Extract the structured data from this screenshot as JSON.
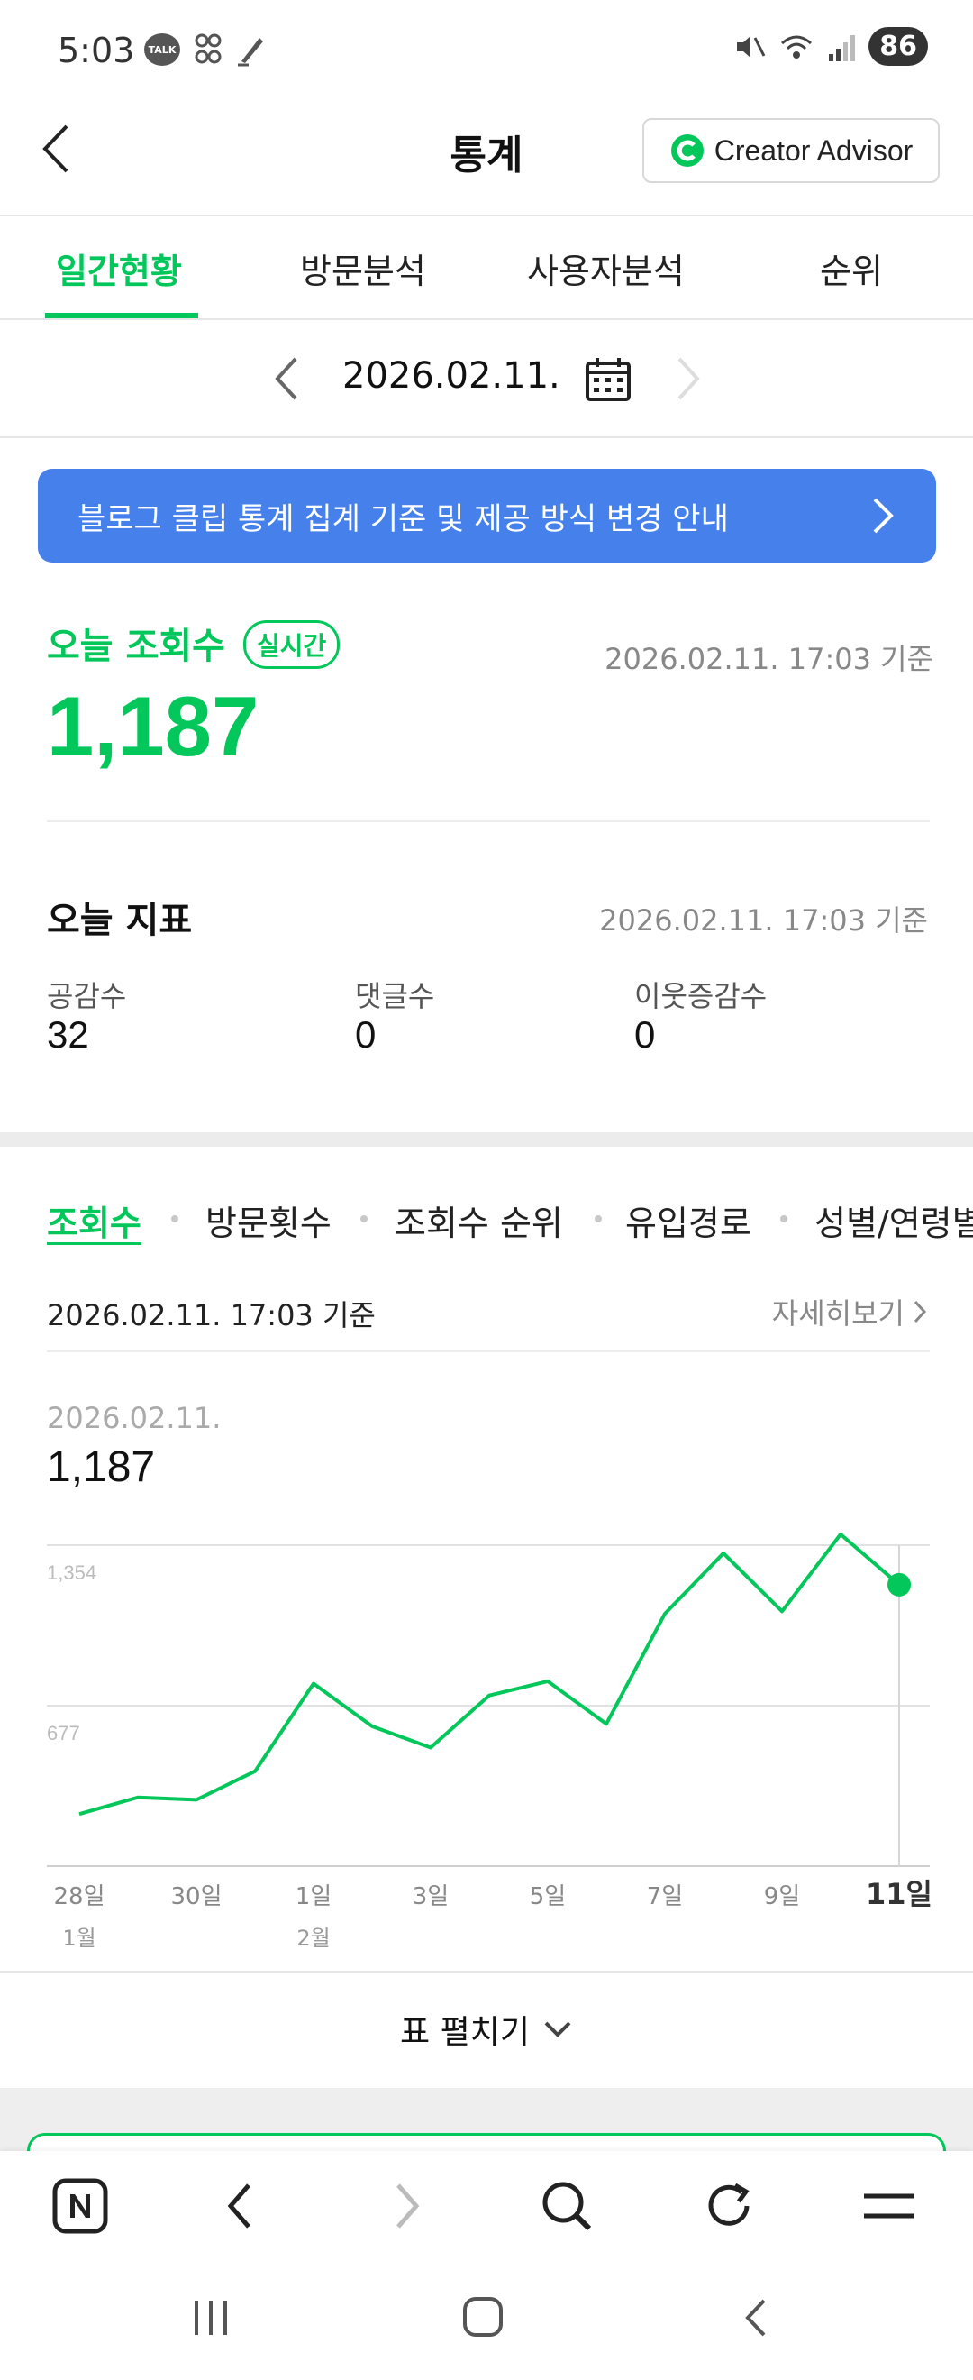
{
  "status_bar": {
    "time": "5:03",
    "talk_badge": "TALK",
    "battery": "86"
  },
  "header": {
    "title": "통계",
    "creator_advisor_label": "Creator Advisor"
  },
  "tabs": [
    {
      "label": "일간현황",
      "active": true
    },
    {
      "label": "방문분석",
      "active": false
    },
    {
      "label": "사용자분석",
      "active": false
    },
    {
      "label": "순위",
      "active": false
    }
  ],
  "date_nav": {
    "date": "2026.02.11."
  },
  "banner": {
    "text": "블로그 클립 통계 집계 기준 및 제공 방식 변경 안내"
  },
  "today_views": {
    "title": "오늘 조회수",
    "badge": "실시간",
    "timestamp": "2026.02.11. 17:03 기준",
    "value": "1,187"
  },
  "today_metrics": {
    "title": "오늘 지표",
    "timestamp": "2026.02.11. 17:03 기준",
    "items": [
      {
        "label": "공감수",
        "value": "32"
      },
      {
        "label": "댓글수",
        "value": "0"
      },
      {
        "label": "이웃증감수",
        "value": "0"
      }
    ]
  },
  "chart_tabs": [
    {
      "label": "조회수",
      "active": true
    },
    {
      "label": "방문횟수",
      "active": false
    },
    {
      "label": "조회수 순위",
      "active": false
    },
    {
      "label": "유입경로",
      "active": false
    },
    {
      "label": "성별/연령별",
      "active": false
    }
  ],
  "chart_section": {
    "timestamp": "2026.02.11. 17:03 기준",
    "detail_link": "자세히보기",
    "selected_date": "2026.02.11.",
    "selected_value": "1,187",
    "expand_label": "표 펼치기"
  },
  "colors": {
    "accent_green": "#03c75a",
    "banner_blue": "#4680ea"
  },
  "chart_data": {
    "type": "line",
    "x": [
      "1월 28일",
      "1월 29일",
      "1월 30일",
      "1월 31일",
      "2월 1일",
      "2월 2일",
      "2월 3일",
      "2월 4일",
      "2월 5일",
      "2월 6일",
      "2월 7일",
      "2월 8일",
      "2월 9일",
      "2월 10일",
      "2월 11일"
    ],
    "tick_labels": [
      {
        "label": "28일",
        "sub": "1월",
        "index": 0
      },
      {
        "label": "30일",
        "sub": "",
        "index": 2
      },
      {
        "label": "1일",
        "sub": "2월",
        "index": 4
      },
      {
        "label": "3일",
        "sub": "",
        "index": 6
      },
      {
        "label": "5일",
        "sub": "",
        "index": 8
      },
      {
        "label": "7일",
        "sub": "",
        "index": 10
      },
      {
        "label": "9일",
        "sub": "",
        "index": 12
      },
      {
        "label": "11일",
        "sub": "",
        "index": 14
      }
    ],
    "series": [
      {
        "values": [
          220,
          290,
          280,
          400,
          770,
          590,
          500,
          720,
          780,
          600,
          1065,
          1320,
          1075,
          1400,
          1187
        ]
      }
    ],
    "y_ticks": [
      677,
      1354
    ],
    "y_tick_labels": [
      "677",
      "1,354"
    ],
    "ylim": [
      0,
      1354
    ],
    "highlight_index": 14,
    "grid": true
  }
}
